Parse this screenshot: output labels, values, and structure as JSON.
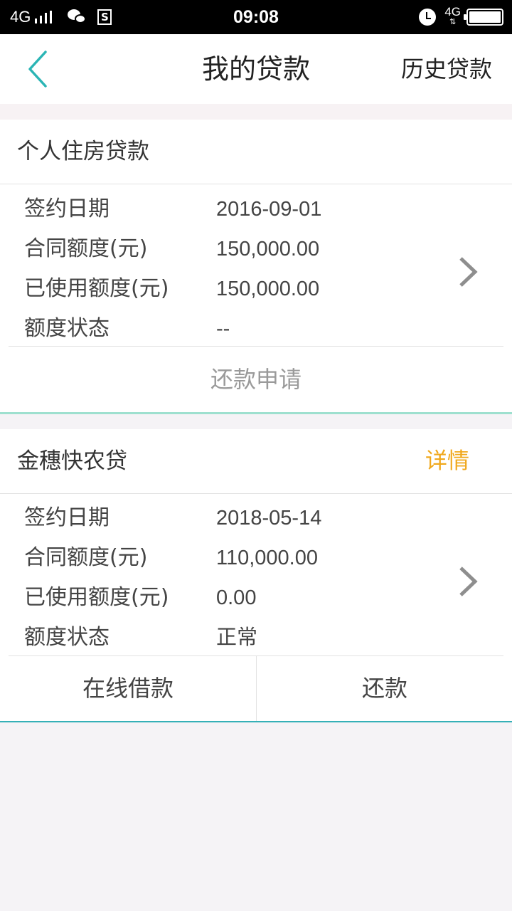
{
  "status_bar": {
    "network": "4G",
    "time": "09:08",
    "s_badge": "S",
    "right_network": "4G"
  },
  "header": {
    "title": "我的贷款",
    "history_label": "历史贷款"
  },
  "loans": [
    {
      "title": "个人住房贷款",
      "fields": [
        {
          "label": "签约日期",
          "value": "2016-09-01"
        },
        {
          "label": "合同额度(元)",
          "value": "150,000.00"
        },
        {
          "label": "已使用额度(元)",
          "value": "150,000.00"
        },
        {
          "label": "额度状态",
          "value": "--"
        }
      ],
      "action": "还款申请"
    },
    {
      "title": "金穗快农贷",
      "detail_label": "详情",
      "fields": [
        {
          "label": "签约日期",
          "value": "2018-05-14"
        },
        {
          "label": "合同额度(元)",
          "value": "110,000.00"
        },
        {
          "label": "已使用额度(元)",
          "value": "0.00"
        },
        {
          "label": "额度状态",
          "value": "正常"
        }
      ],
      "actions": [
        "在线借款",
        "还款"
      ]
    }
  ],
  "colors": {
    "accent_teal": "#2bb5b5",
    "detail_orange": "#f0a81c",
    "disabled_gray": "#9a9a9a"
  },
  "icons": {
    "back": "chevron-left-icon",
    "row_arrow": "chevron-right-icon"
  }
}
